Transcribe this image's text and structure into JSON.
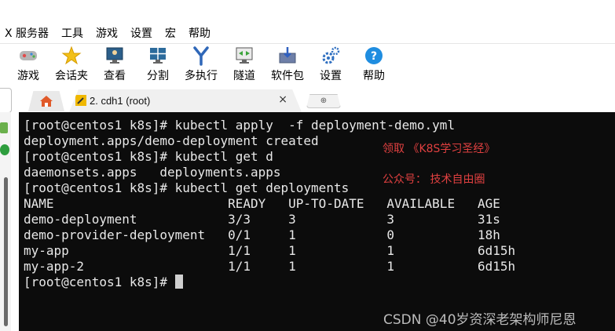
{
  "menu": [
    "X 服务器",
    "工具",
    "游戏",
    "设置",
    "宏",
    "帮助"
  ],
  "toolbar": [
    {
      "label": "游戏",
      "icon": "gamepad-icon"
    },
    {
      "label": "会话夹",
      "icon": "star-icon"
    },
    {
      "label": "查看",
      "icon": "monitor-icon"
    },
    {
      "label": "分割",
      "icon": "split-icon"
    },
    {
      "label": "多执行",
      "icon": "fork-icon"
    },
    {
      "label": "隧道",
      "icon": "tunnel-icon"
    },
    {
      "label": "软件包",
      "icon": "package-icon"
    },
    {
      "label": "设置",
      "icon": "gears-icon"
    },
    {
      "label": "帮助",
      "icon": "help-icon"
    }
  ],
  "tabs": {
    "active_title": "2. cdh1 (root)",
    "close_glyph": "×"
  },
  "terminal": {
    "lines": [
      "[root@centos1 k8s]# kubectl apply  -f deployment-demo.yml",
      "deployment.apps/demo-deployment created",
      "[root@centos1 k8s]# kubectl get d",
      "daemonsets.apps   deployments.apps",
      "[root@centos1 k8s]# kubectl get deployments",
      "NAME                       READY   UP-TO-DATE   AVAILABLE   AGE",
      "demo-deployment            3/3     3            3           31s",
      "demo-provider-deployment   0/1     1            0           18h",
      "my-app                     1/1     1            1           6d15h",
      "my-app-2                   1/1     1            1           6d15h"
    ],
    "prompt": "[root@centos1 k8s]# "
  },
  "annotations": {
    "note1": "领取 《K8S学习圣经》",
    "note2": "公众号： 技术自由圈"
  },
  "watermark": "CSDN @40岁资深老架构师尼恩",
  "colors": {
    "terminal_bg": "#0c0c0c",
    "terminal_fg": "#e8e8e8",
    "note": "#e04040"
  }
}
